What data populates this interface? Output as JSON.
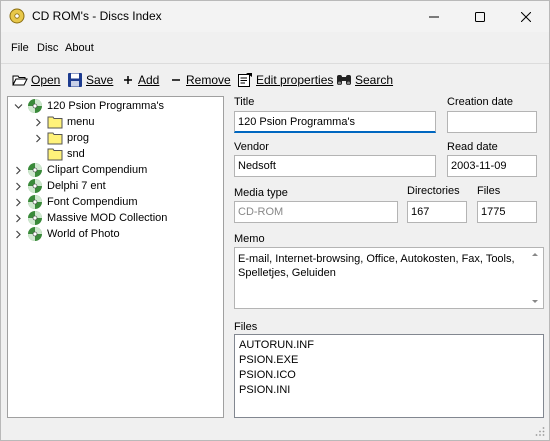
{
  "window": {
    "title": "CD ROM's - Discs Index"
  },
  "menu": [
    "File",
    "Disc",
    "About"
  ],
  "toolbar": {
    "open": "Open",
    "save": "Save",
    "add": "Add",
    "remove": "Remove",
    "edit_properties": "Edit properties",
    "search": "Search"
  },
  "tree": {
    "selected": "120 Psion Programma's",
    "selected_children": [
      "menu",
      "prog",
      "snd"
    ],
    "discs": [
      "Clipart Compendium",
      "Delphi 7 ent",
      "Font Compendium",
      "Massive MOD Collection",
      "World of Photo"
    ]
  },
  "form": {
    "title_label": "Title",
    "title_value": "120 Psion Programma's",
    "creation_date_label": "Creation date",
    "creation_date_value": "",
    "vendor_label": "Vendor",
    "vendor_value": "Nedsoft",
    "read_date_label": "Read date",
    "read_date_value": "2003-11-09",
    "media_type_label": "Media type",
    "media_type_value": "CD-ROM",
    "directories_label": "Directories",
    "directories_value": "167",
    "files_count_label": "Files",
    "files_count_value": "1775",
    "memo_label": "Memo",
    "memo_value": "E-mail, Internet-browsing, Office, Autokosten, Fax, Tools, Spelletjes, Geluiden",
    "files_label": "Files",
    "files_list": [
      "AUTORUN.INF",
      "PSION.EXE",
      "PSION.ICO",
      "PSION.INI"
    ]
  }
}
